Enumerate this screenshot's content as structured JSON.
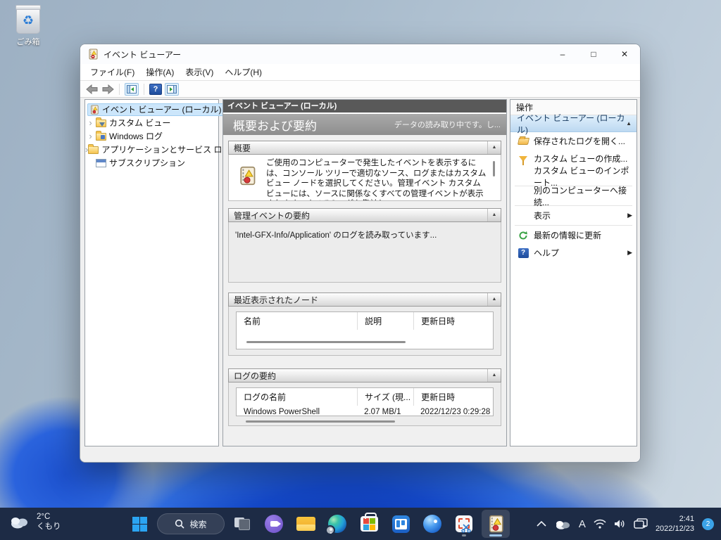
{
  "desktop": {
    "recycle_bin_label": "ごみ箱"
  },
  "window": {
    "title": "イベント ビューアー",
    "controls": {
      "minimize": "–",
      "maximize": "□",
      "close": "✕"
    },
    "menu": [
      "ファイル(F)",
      "操作(A)",
      "表示(V)",
      "ヘルプ(H)"
    ],
    "tree": {
      "expander": "›",
      "items": [
        {
          "label": "イベント ビューアー (ローカル)"
        },
        {
          "label": "カスタム ビュー"
        },
        {
          "label": "Windows ログ"
        },
        {
          "label": "アプリケーションとサービス ログ"
        },
        {
          "label": "サブスクリプション"
        }
      ]
    },
    "main": {
      "breadcrumb": "イベント ビューアー (ローカル)",
      "page_title": "概要および要約",
      "loading_status": "データの読み取り中です。し...",
      "collapse_glyph": "▲",
      "overview": {
        "title": "概要",
        "body": "ご使用のコンピューターで発生したイベントを表示するには、コンソール ツリーで適切なソース、ログまたはカスタム ビュー ノードを選択してください。管理イベント カスタム ビューには、ソースに関係なくすべての管理イベントが表示されます。すべてのログを集計し"
      },
      "admin_summary": {
        "title": "管理イベントの要約",
        "status": "'Intel-GFX-Info/Application' のログを読み取っています..."
      },
      "recent_nodes": {
        "title": "最近表示されたノード",
        "columns": [
          "名前",
          "説明",
          "更新日時"
        ]
      },
      "log_summary": {
        "title": "ログの要約",
        "columns": [
          "ログの名前",
          "サイズ (現...",
          "更新日時"
        ],
        "row": [
          "Windows PowerShell",
          "2.07 MB/1",
          "2022/12/23 0:29:28"
        ]
      }
    },
    "actions": {
      "panel_title": "操作",
      "group_title": "イベント ビューアー (ローカル)",
      "collapse_glyph": "▲",
      "submenu_glyph": "▶",
      "items": [
        {
          "label": "保存されたログを開く..."
        },
        {
          "label": "カスタム ビューの作成..."
        },
        {
          "label": "カスタム ビューのインポート..."
        },
        {
          "label": "別のコンピューターへ接続..."
        },
        {
          "label": "表示"
        },
        {
          "label": "最新の情報に更新"
        },
        {
          "label": "ヘルプ"
        }
      ]
    }
  },
  "taskbar": {
    "weather": {
      "temperature": "2°C",
      "condition": "くもり"
    },
    "search": {
      "label": "検索"
    },
    "tray": {
      "ime": "A",
      "time": "2:41",
      "date": "2022/12/23",
      "notification_count": "2"
    }
  }
}
